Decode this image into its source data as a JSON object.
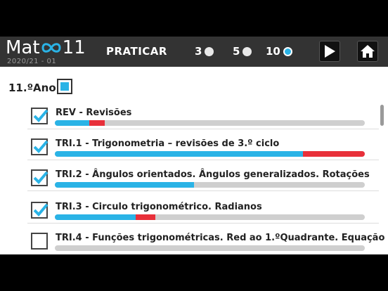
{
  "app": {
    "logo_prefix": "Mat",
    "logo_suffix": "11",
    "version": "2020/21 - 01"
  },
  "header": {
    "praticar_label": "PRATICAR",
    "options": [
      {
        "label": "3",
        "selected": false
      },
      {
        "label": "5",
        "selected": false
      },
      {
        "label": "10",
        "selected": true
      }
    ],
    "play_icon": "play-icon",
    "home_icon": "home-icon"
  },
  "year": {
    "label": "11.ºAno",
    "state": "partial"
  },
  "colors": {
    "accent": "#2ab3e6",
    "error": "#e8303a",
    "track": "#cfcfcf"
  },
  "topics": [
    {
      "label": "REV  - Revisões",
      "checked": true,
      "correct": 0.11,
      "wrong": 0.05
    },
    {
      "label": "TRI.1 - Trigonometria – revisões de 3.º ciclo",
      "checked": true,
      "correct": 0.8,
      "wrong": 0.2
    },
    {
      "label": "TRI.2 - Ângulos orientados. Ângulos generalizados. Rotações",
      "checked": true,
      "correct": 0.45,
      "wrong": 0.0
    },
    {
      "label": "TRI.3 - Circulo trigonométrico. Radianos",
      "checked": true,
      "correct": 0.26,
      "wrong": 0.06
    },
    {
      "label": "TRI.4 - Funções trigonométricas. Red ao 1.ºQuadrante. Equação",
      "checked": false,
      "correct": 0.0,
      "wrong": 0.0
    }
  ]
}
